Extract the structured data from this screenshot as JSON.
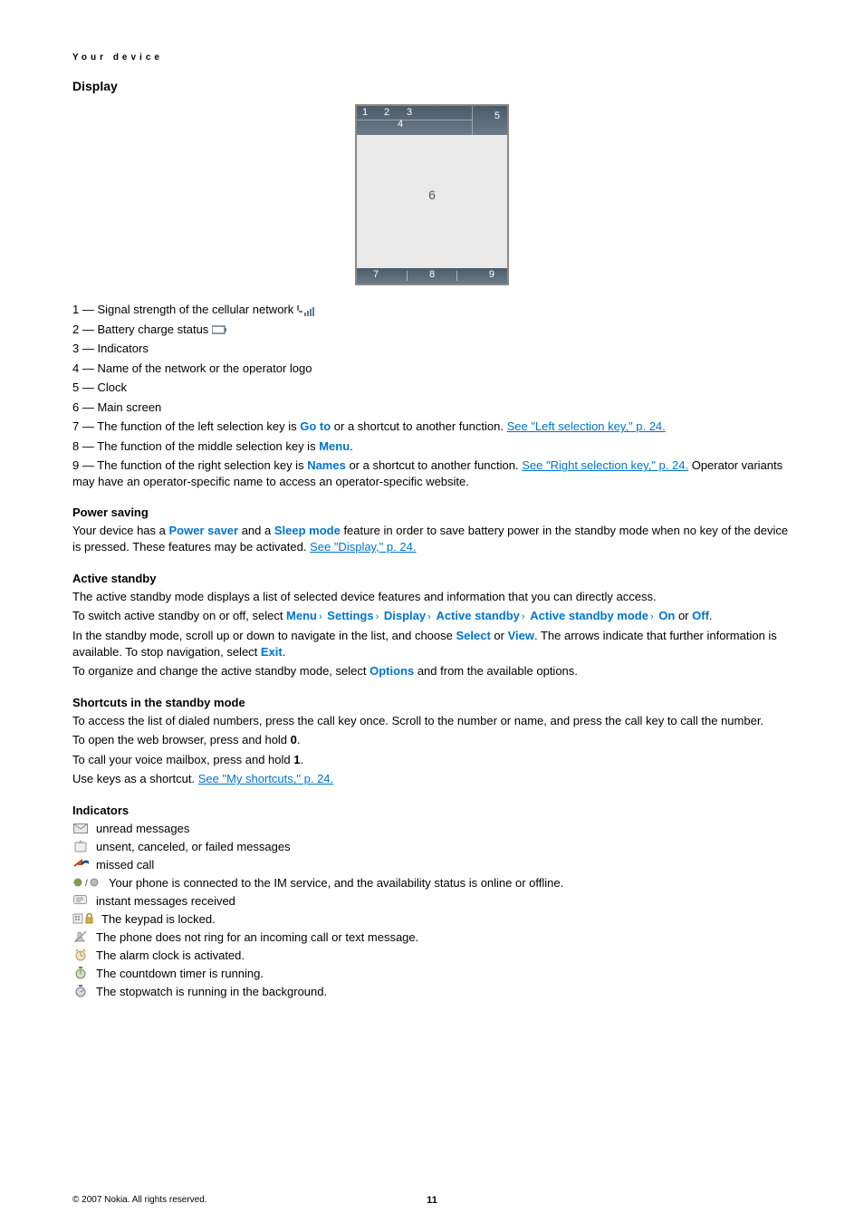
{
  "running_header": "Your device",
  "section": "Display",
  "diagram": {
    "n1": "1",
    "n2": "2",
    "n3": "3",
    "n4": "4",
    "n5": "5",
    "n6": "6",
    "n7": "7",
    "n8": "8",
    "n9": "9"
  },
  "items": [
    {
      "num": "1",
      "text": "— Signal strength of the cellular network "
    },
    {
      "num": "2",
      "text": "— Battery charge status "
    },
    {
      "num": "3",
      "text": "— Indicators"
    },
    {
      "num": "4",
      "text": "— Name of the network or the operator logo"
    },
    {
      "num": "5",
      "text": "— Clock"
    },
    {
      "num": "6",
      "text": "— Main screen"
    }
  ],
  "item7_pre": "7 — The function of the left selection key is ",
  "item7_bold": "Go to",
  "item7_mid": " or a shortcut to another function. ",
  "item7_link": "See \"Left selection key,\" p. 24.",
  "item8_pre": "8 — The function of the middle selection key is ",
  "item8_bold": "Menu",
  "item8_post": ".",
  "item9_pre": "9 — The function of the right selection key is ",
  "item9_bold": "Names",
  "item9_mid": " or a shortcut to another function. ",
  "item9_link": "See \"Right selection key,\" p. 24.",
  "item9_post": " Operator variants may have an operator-specific name to access an operator-specific website.",
  "power_h": "Power saving",
  "power_pre": "Your device has a ",
  "power_b1": "Power saver",
  "power_mid1": " and a ",
  "power_b2": "Sleep mode",
  "power_mid2": " feature in order to save battery power in the standby mode when no key of the device is pressed. These features may be activated. ",
  "power_link": "See \"Display,\" p. 24.",
  "active_h": "Active standby",
  "active_p1": "The active standby mode displays a list of selected device features and information that you can directly access.",
  "active_p2_pre": "To switch active standby on or off, select ",
  "crumbs": [
    "Menu",
    "Settings",
    "Display",
    "Active standby",
    "Active standby mode",
    "On"
  ],
  "active_p2_or": " or ",
  "active_p2_off": "Off",
  "active_p2_post": ".",
  "active_p3_pre": "In the standby mode, scroll up or down to navigate in the list, and choose ",
  "active_p3_b1": "Select",
  "active_p3_mid": " or ",
  "active_p3_b2": "View",
  "active_p3_post": ". The arrows indicate that further information is available. To stop navigation, select ",
  "active_p3_b3": "Exit",
  "active_p3_end": ".",
  "active_p4_pre": "To organize and change the active standby mode, select ",
  "active_p4_b": "Options",
  "active_p4_post": " and from the available options.",
  "short_h": "Shortcuts in the standby mode",
  "short_p1": "To access the list of dialed numbers, press the call key once. Scroll to the number or name, and press the call key to call the number.",
  "short_p2_pre": "To open the web browser, press and hold ",
  "short_p2_b": "0",
  "short_p2_post": ".",
  "short_p3_pre": "To call your voice mailbox, press and hold ",
  "short_p3_b": "1",
  "short_p3_post": ".",
  "short_p4_pre": "Use keys as a shortcut. ",
  "short_p4_link": "See \"My shortcuts,\" p. 24.",
  "ind_h": "Indicators",
  "ind": [
    "unread messages",
    "unsent, canceled, or failed messages",
    "missed call",
    "Your phone is connected to the IM service, and the availability status is online or offline.",
    "instant messages received",
    "The keypad is locked.",
    "The phone does not ring for an incoming call or text message.",
    "The alarm clock is activated.",
    "The countdown timer is running.",
    "The stopwatch is running in the background."
  ],
  "im_slash": "/",
  "copyright": "© 2007 Nokia. All rights reserved.",
  "pagenum": "11"
}
